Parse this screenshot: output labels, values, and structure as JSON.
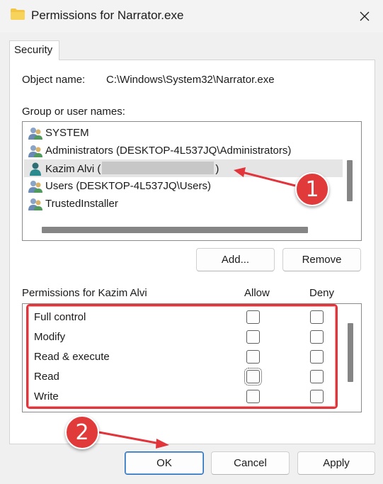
{
  "window": {
    "title": "Permissions for Narrator.exe",
    "tab": "Security"
  },
  "object": {
    "label": "Object name:",
    "value": "C:\\Windows\\System32\\Narrator.exe"
  },
  "users": {
    "label": "Group or user names:",
    "items": [
      {
        "name": "SYSTEM",
        "icon": "group-users-icon"
      },
      {
        "name": "Administrators (DESKTOP-4L537JQ\\Administrators)",
        "icon": "group-users-icon"
      },
      {
        "name_prefix": "Kazim Alvi (",
        "name_suffix": ")",
        "icon": "user-icon",
        "selected": true
      },
      {
        "name": "Users (DESKTOP-4L537JQ\\Users)",
        "icon": "group-users-icon"
      },
      {
        "name": "TrustedInstaller",
        "icon": "group-users-icon"
      }
    ]
  },
  "buttons": {
    "add": "Add...",
    "remove": "Remove",
    "ok": "OK",
    "cancel": "Cancel",
    "apply": "Apply"
  },
  "permissions": {
    "label": "Permissions for Kazim Alvi",
    "allow_header": "Allow",
    "deny_header": "Deny",
    "items": [
      {
        "name": "Full control",
        "allow": false,
        "deny": false
      },
      {
        "name": "Modify",
        "allow": false,
        "deny": false
      },
      {
        "name": "Read & execute",
        "allow": false,
        "deny": false
      },
      {
        "name": "Read",
        "allow": false,
        "deny": false
      },
      {
        "name": "Write",
        "allow": false,
        "deny": false
      }
    ]
  },
  "annotations": {
    "badge1": "1",
    "badge2": "2",
    "color": "#e1343b"
  }
}
